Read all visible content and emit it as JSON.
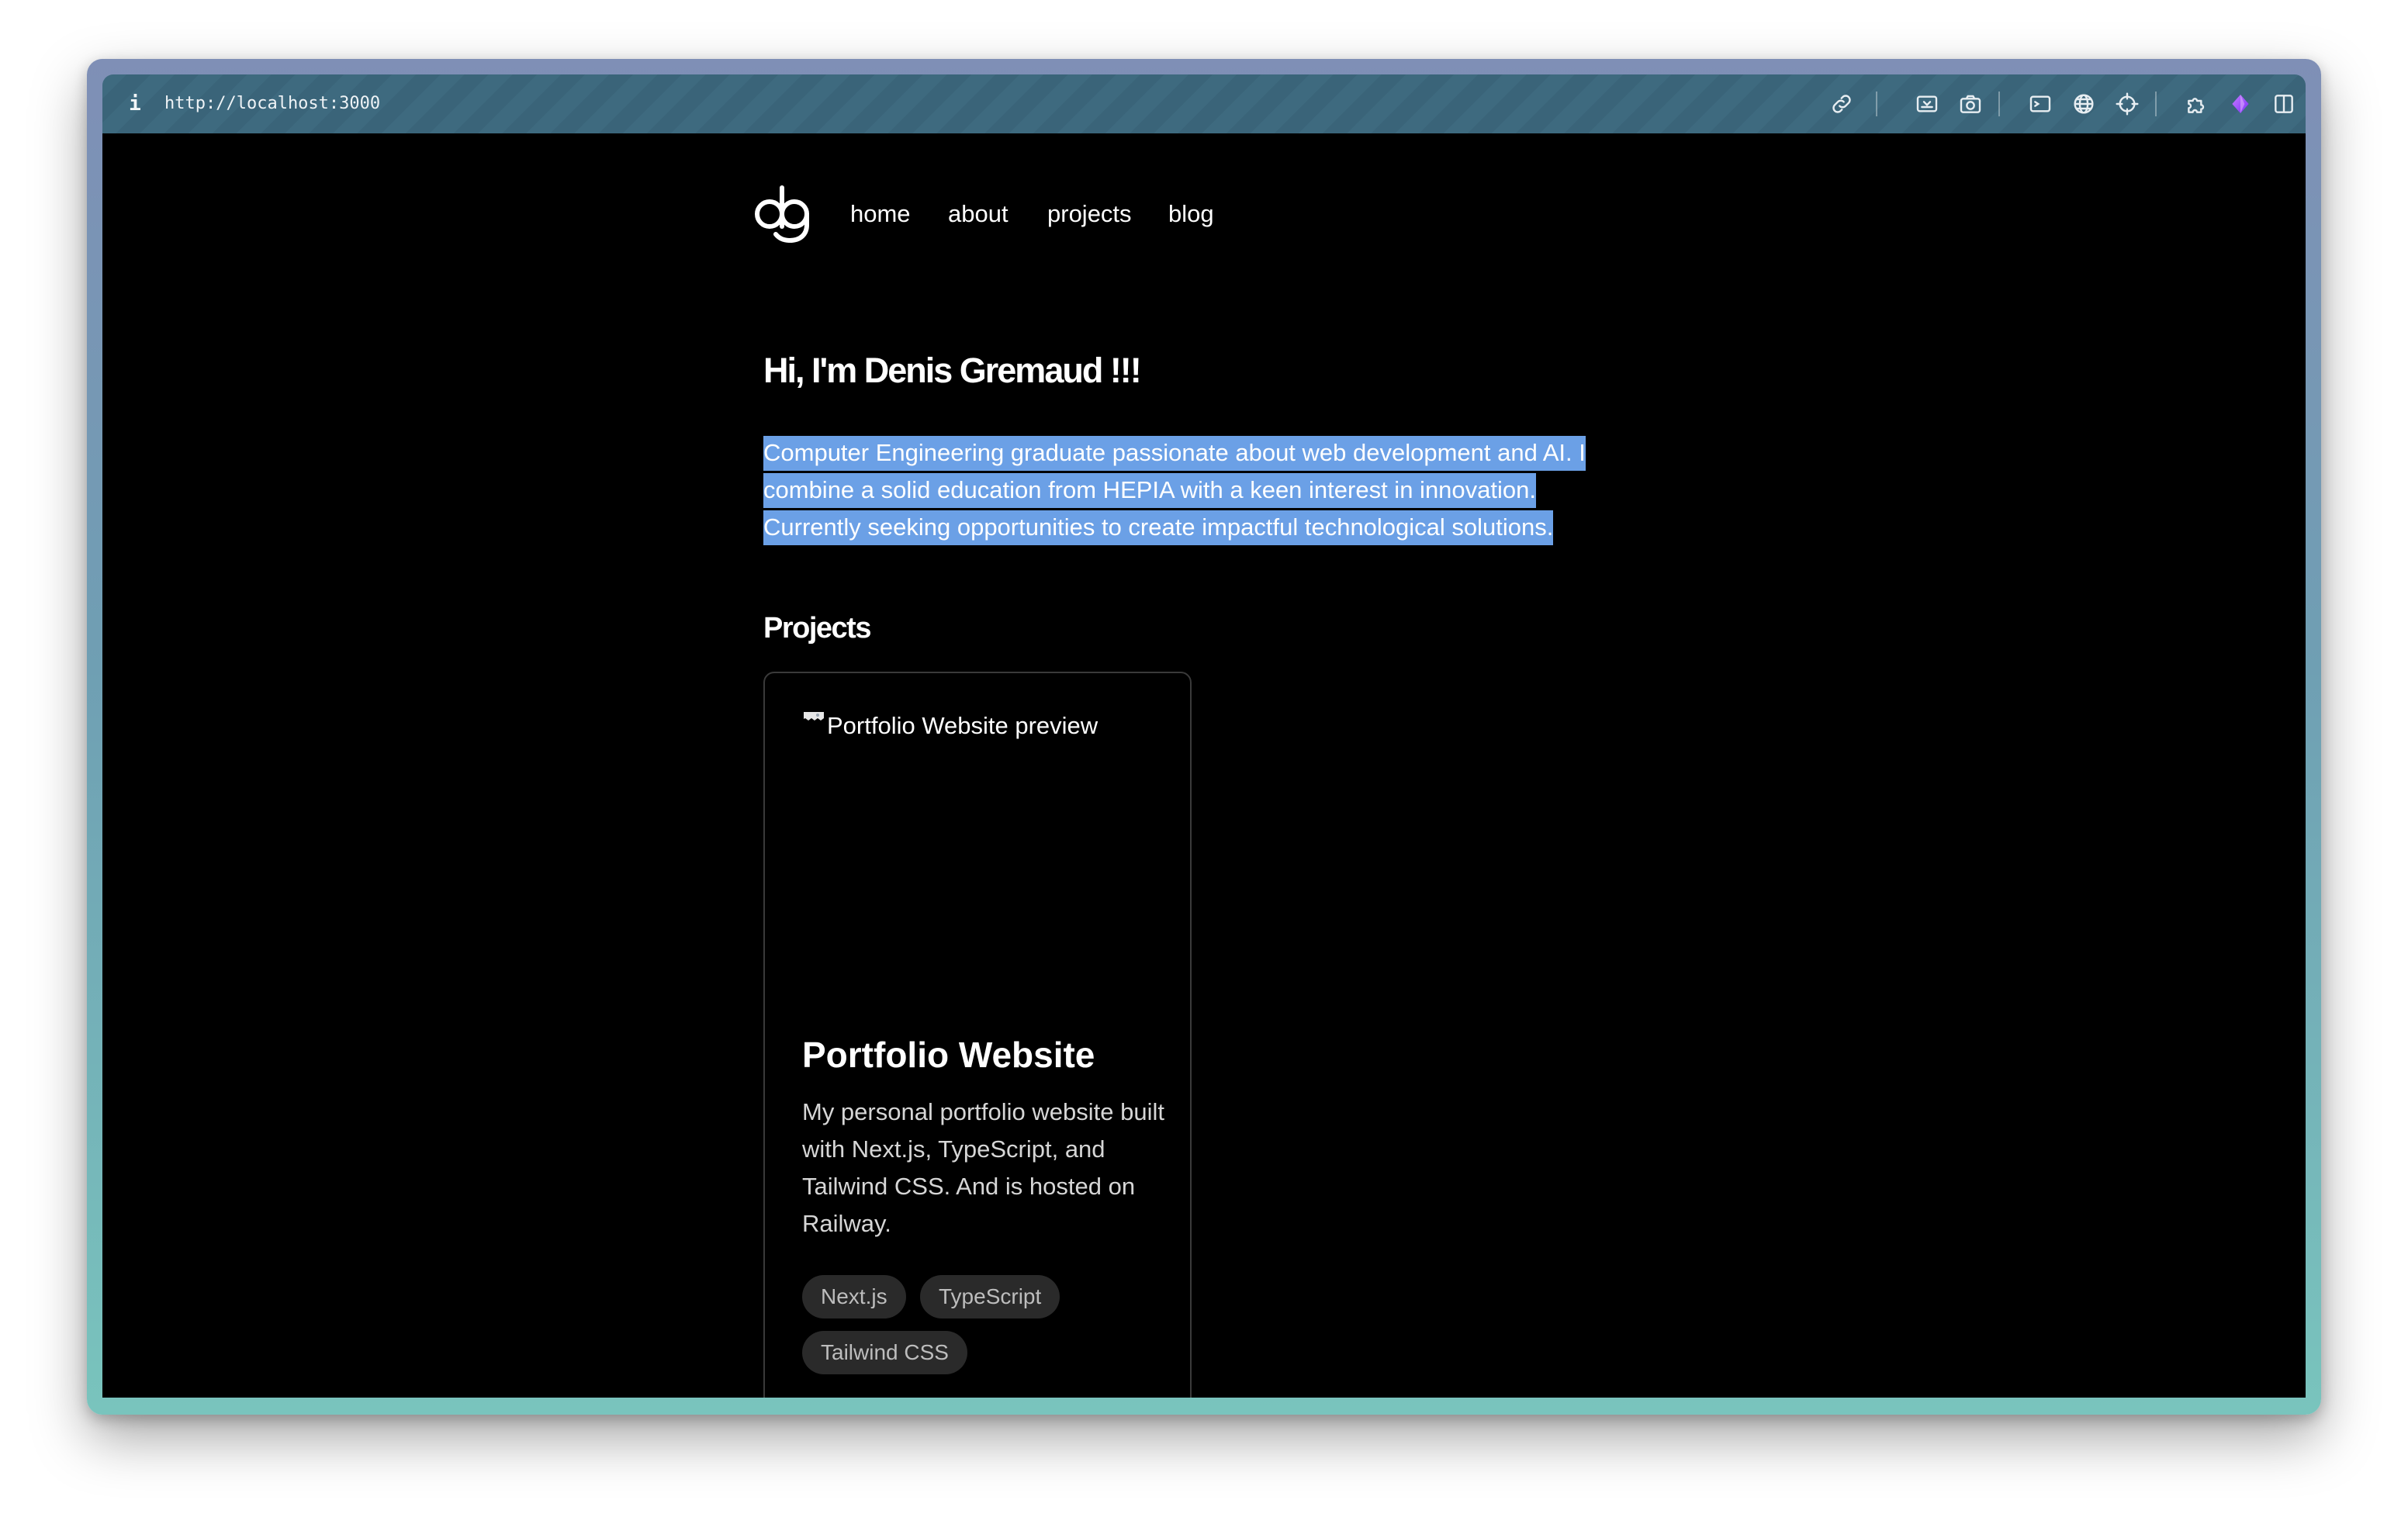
{
  "browser": {
    "url": "http://localhost:3000",
    "info_icon": "i",
    "toolbar_icons": [
      "link-icon",
      "screenshot-area-icon",
      "camera-icon",
      "terminal-icon",
      "globe-icon",
      "crosshair-icon",
      "extension-puzzle-icon",
      "gem-icon",
      "split-view-icon"
    ]
  },
  "nav": {
    "logo_alt": "dg",
    "links": [
      "home",
      "about",
      "projects",
      "blog"
    ]
  },
  "hero": {
    "title": "Hi, I'm Denis Gremaud !!!",
    "bio_lines": [
      "Computer Engineering graduate passionate about web development and AI. I",
      "combine a solid education from HEPIA with a keen interest in innovation.",
      "Currently seeking opportunities to create impactful technological solutions."
    ]
  },
  "projects": {
    "heading": "Projects",
    "items": [
      {
        "image_alt": "Portfolio Website preview",
        "title": "Portfolio Website",
        "description": "My personal portfolio website built with Next.js, TypeScript, and Tailwind CSS. And is hosted on Railway.",
        "tags": [
          "Next.js",
          "TypeScript",
          "Tailwind CSS"
        ]
      }
    ]
  },
  "colors": {
    "page_background": "#000000",
    "selection_highlight": "#6ba0e6",
    "tag_background": "#2a2a2a",
    "card_border": "#3a3a3a"
  }
}
